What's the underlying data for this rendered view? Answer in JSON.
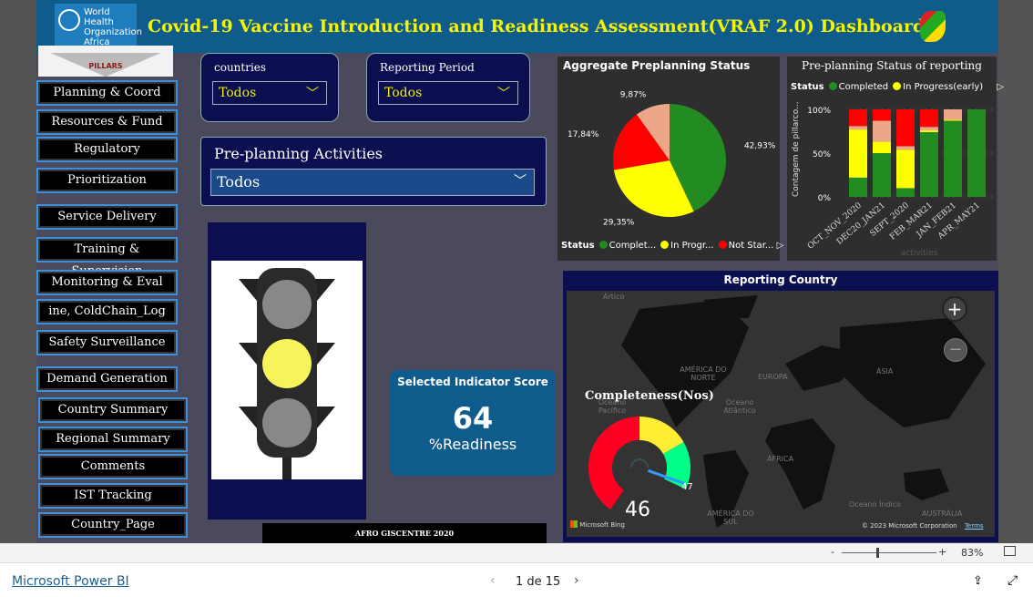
{
  "header": {
    "title": "Covid-19 Vaccine Introduction and Readiness Assessment(VRAF 2.0) Dashboard",
    "logo_text": [
      "World Health",
      "Organization",
      "Africa"
    ],
    "pillars_label": "PILLARS"
  },
  "nav": [
    "Planning & Coord",
    "Resources & Fund",
    "Regulatory",
    "Prioritization",
    "Service Delivery",
    "Training & Supervision",
    "Monitoring & Eval",
    "ine, ColdChain_Log",
    "Safety Surveillance",
    "Demand Generation",
    "Country Summary",
    "Regional Summary",
    "Comments",
    "IST Tracking",
    "Country_Page"
  ],
  "filters": {
    "countries": {
      "label": "countries",
      "value": "Todos"
    },
    "period": {
      "label": "Reporting Period",
      "value": "Todos"
    },
    "activities": {
      "label": "Pre-planning Activities",
      "value": "Todos"
    }
  },
  "traffic_light": {
    "active": "yellow"
  },
  "score": {
    "title": "Selected Indicator Score",
    "value": "64",
    "unit": "%Readiness"
  },
  "footer_credit": "AFRO GISCENTRE 2020",
  "colors": {
    "completed": "#228b22",
    "in_progress": "#ffff00",
    "not_started": "#ff0000",
    "other": "#eda688"
  },
  "chart_data": [
    {
      "type": "pie",
      "title": "Aggregate Preplanning Status",
      "legend_title": "Status",
      "legend": [
        "Complet...",
        "In Progr...",
        "Not Star..."
      ],
      "slices": [
        {
          "label": "42,93%",
          "value": 42.93,
          "color": "#228b22"
        },
        {
          "label": "29,35%",
          "value": 29.35,
          "color": "#ffff00"
        },
        {
          "label": "17,84%",
          "value": 17.84,
          "color": "#ff0000"
        },
        {
          "label": "9,87%",
          "value": 9.87,
          "color": "#eda688"
        }
      ]
    },
    {
      "type": "bar",
      "stacked": "100%",
      "title": "Pre-planning Status of reporting",
      "legend_title": "Status",
      "legend": [
        "Completed",
        "In Progress(early)"
      ],
      "ylabel": "Contagem de pillarco...",
      "xlabel": "activities",
      "yticks": [
        "0%",
        "50%",
        "100%"
      ],
      "categories": [
        "OCT_NOV_2020",
        "DEC20_JAN21",
        "SEPT_2020",
        "FEB_MAR21",
        "JAN_FEB21",
        "APR_MAY21"
      ],
      "series": [
        {
          "color": "#228b22",
          "values": [
            22,
            50,
            10,
            74,
            87,
            100
          ]
        },
        {
          "color": "#ffff00",
          "values": [
            55,
            13,
            44,
            2,
            1,
            0
          ]
        },
        {
          "color": "#eda688",
          "values": [
            4,
            24,
            4,
            4,
            12,
            0
          ]
        },
        {
          "color": "#ff0000",
          "values": [
            19,
            13,
            42,
            20,
            0,
            0
          ]
        }
      ]
    },
    {
      "type": "gauge",
      "title": "Completeness(Nos)",
      "value": 46,
      "max_label": "47"
    }
  ],
  "map": {
    "title": "Reporting Country",
    "labels": [
      "Ártico",
      "AMÉRICA DO NORTE",
      "EUROPA",
      "ÁSIA",
      "Oceano Pacífico",
      "Oceano Atlântico",
      "ÁFRICA",
      "AMÉRICA DO SUL",
      "Oceano Índico",
      "AUSTRÁLIA"
    ],
    "bing": "Microsoft Bing",
    "copyright": "© 2023 Microsoft Corporation",
    "terms": "Terms"
  },
  "bottom": {
    "zoom": "83%",
    "brand": "Microsoft Power BI",
    "page": "1 de 15"
  }
}
